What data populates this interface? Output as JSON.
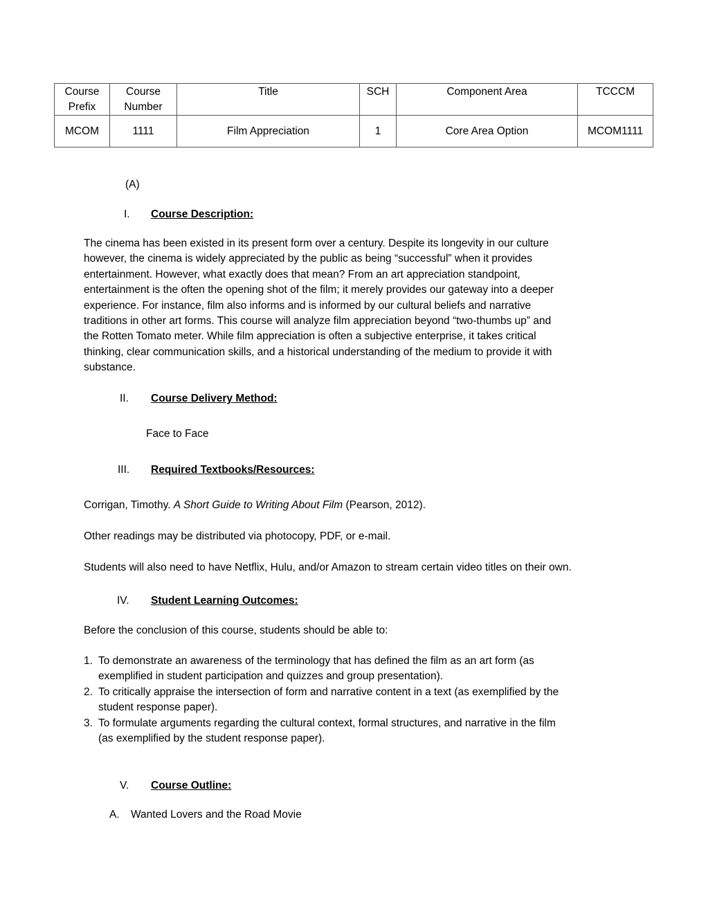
{
  "course_table": {
    "headers": [
      {
        "line1": "Course",
        "line2": "Prefix"
      },
      {
        "line1": "Course",
        "line2": "Number"
      },
      {
        "line1": "Title",
        "line2": ""
      },
      {
        "line1": "SCH",
        "line2": ""
      },
      {
        "line1": "Component Area",
        "line2": ""
      },
      {
        "line1": "TCCCM",
        "line2": ""
      }
    ],
    "row": [
      "MCOM",
      "1111",
      "Film Appreciation",
      "1",
      "Core Area Option",
      "MCOM1111"
    ]
  },
  "section_marker": "(A)",
  "sections": {
    "description": {
      "numeral": "I.",
      "label": "Course Description:",
      "lines": [
        "The cinema has been existed in its present form over a century.  Despite its longevity in our culture",
        "however, the cinema is widely appreciated by the public as being “successful” when it provides",
        "entertainment.  However, what exactly does that mean?  From an art appreciation standpoint,",
        "entertainment is the often the opening shot of the film; it merely provides our gateway into a deeper",
        "experience.  For instance, film also informs and is informed by our cultural beliefs and narrative",
        "traditions in other art forms.  This course will analyze film appreciation beyond “two-thumbs up” and",
        "the Rotten Tomato meter.  While film appreciation is often a subjective enterprise, it takes critical",
        "thinking, clear communication skills, and a historical understanding of the medium to provide it with",
        "substance."
      ]
    },
    "delivery": {
      "numeral": "II.",
      "label": "Course Delivery Method:",
      "value": "Face to Face"
    },
    "textbooks": {
      "numeral": "III.",
      "label": "Required Textbooks/Resources:",
      "citation_author": "Corrigan, Timothy.  ",
      "citation_title": "A Short Guide to Writing About Film",
      "citation_pub": " (Pearson, 2012).",
      "other_readings": "Other readings may be distributed via photocopy, PDF, or e-mail.",
      "streaming": "Students will also need to have Netflix, Hulu, and/or Amazon to stream certain video titles on their own."
    },
    "outcomes": {
      "numeral": "IV.",
      "label": "Student Learning Outcomes:",
      "intro": "Before the conclusion of this course, students should be able to:",
      "items": [
        {
          "num": "1.",
          "line1": "To demonstrate an awareness of the terminology that has defined the film as an art form (as",
          "line2": "exemplified in student participation and quizzes and group presentation)."
        },
        {
          "num": "2.",
          "line1": "To critically appraise the intersection of form and narrative content in a text (as exemplified by the",
          "line2": "student response paper)."
        },
        {
          "num": "3.",
          "line1": "To formulate arguments regarding the cultural context, formal structures, and narrative in the film",
          "line2": "(as exemplified by the student response paper)."
        }
      ]
    },
    "outline": {
      "numeral": "V.",
      "label": "Course Outline:",
      "items": [
        {
          "letter": "A.",
          "text": "Wanted Lovers and the Road Movie"
        }
      ]
    }
  }
}
